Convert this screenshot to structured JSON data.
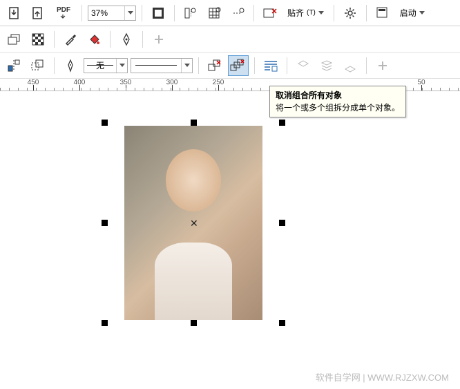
{
  "toolbar1": {
    "zoom_value": "37%",
    "pdf_label": "PDF",
    "align_label": "贴齐",
    "launch_label": "启动"
  },
  "toolbar3": {
    "fill_label": "无"
  },
  "tooltip": {
    "title": "取消组合所有对象",
    "desc": "将一个或多个组拆分成单个对象。"
  },
  "ruler_ticks": [
    {
      "pos": 48,
      "label": "450"
    },
    {
      "pos": 115,
      "label": "400"
    },
    {
      "pos": 182,
      "label": "350"
    },
    {
      "pos": 249,
      "label": "300"
    },
    {
      "pos": 316,
      "label": "250"
    },
    {
      "pos": 610,
      "label": "50"
    }
  ],
  "watermark": "软件自学网 | WWW.RJZXW.COM"
}
